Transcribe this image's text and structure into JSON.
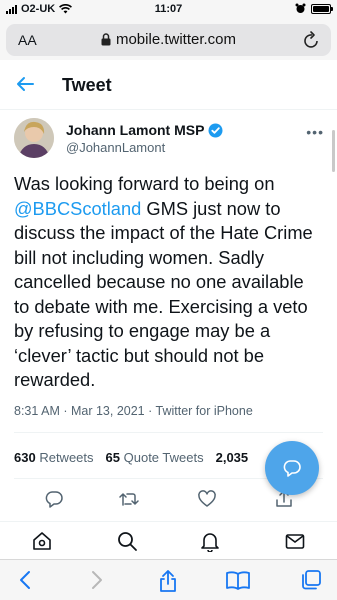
{
  "status_bar": {
    "carrier": "O2-UK",
    "time": "11:07"
  },
  "browser": {
    "text_size_label": "AA",
    "url": "mobile.twitter.com"
  },
  "header": {
    "title": "Tweet"
  },
  "tweet": {
    "author_name": "Johann Lamont MSP",
    "author_handle": "@JohannLamont",
    "text_lines": [
      {
        "plain": "Was looking forward to being on"
      },
      {
        "mention": "@BBCScotland",
        "plain": " GMS just now to"
      },
      {
        "plain": "discuss  the impact of the Hate Crime"
      },
      {
        "plain": "bill not including women. Sadly"
      },
      {
        "plain": "cancelled because no one available"
      },
      {
        "plain": "to  debate with me. Exercising a veto"
      },
      {
        "plain": "by refusing to engage may be a"
      },
      {
        "plain": "‘clever’ tactic but should not be"
      },
      {
        "plain": "rewarded."
      }
    ],
    "meta": "8:31 AM · Mar 13, 2021 · Twitter for iPhone",
    "retweets_count": "630",
    "retweets_label": "Retweets",
    "quote_count": "65",
    "quote_label": "Quote Tweets",
    "likes_count": "2,035"
  },
  "colors": {
    "accent": "#1d9bf0",
    "fab": "#4ea5ea",
    "secondary_text": "#536471",
    "verified": "#1d9bf0"
  }
}
